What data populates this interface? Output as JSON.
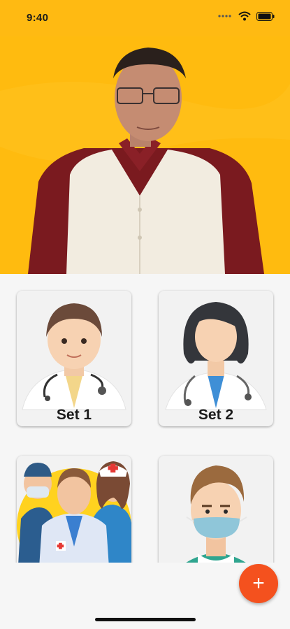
{
  "status_bar": {
    "time": "9:40"
  },
  "hero": {
    "image": "presenter-photo"
  },
  "cards": [
    {
      "label": "Set 1",
      "illustration": "male-doctor"
    },
    {
      "label": "Set 2",
      "illustration": "female-doctor"
    },
    {
      "label": "",
      "illustration": "medical-team"
    },
    {
      "label": "",
      "illustration": "masked-man"
    }
  ],
  "fab": {
    "icon": "plus-icon",
    "glyph": "+",
    "color": "#f4511e"
  },
  "colors": {
    "hero_background": "#ffbb0f",
    "page_background": "#f6f6f6"
  }
}
